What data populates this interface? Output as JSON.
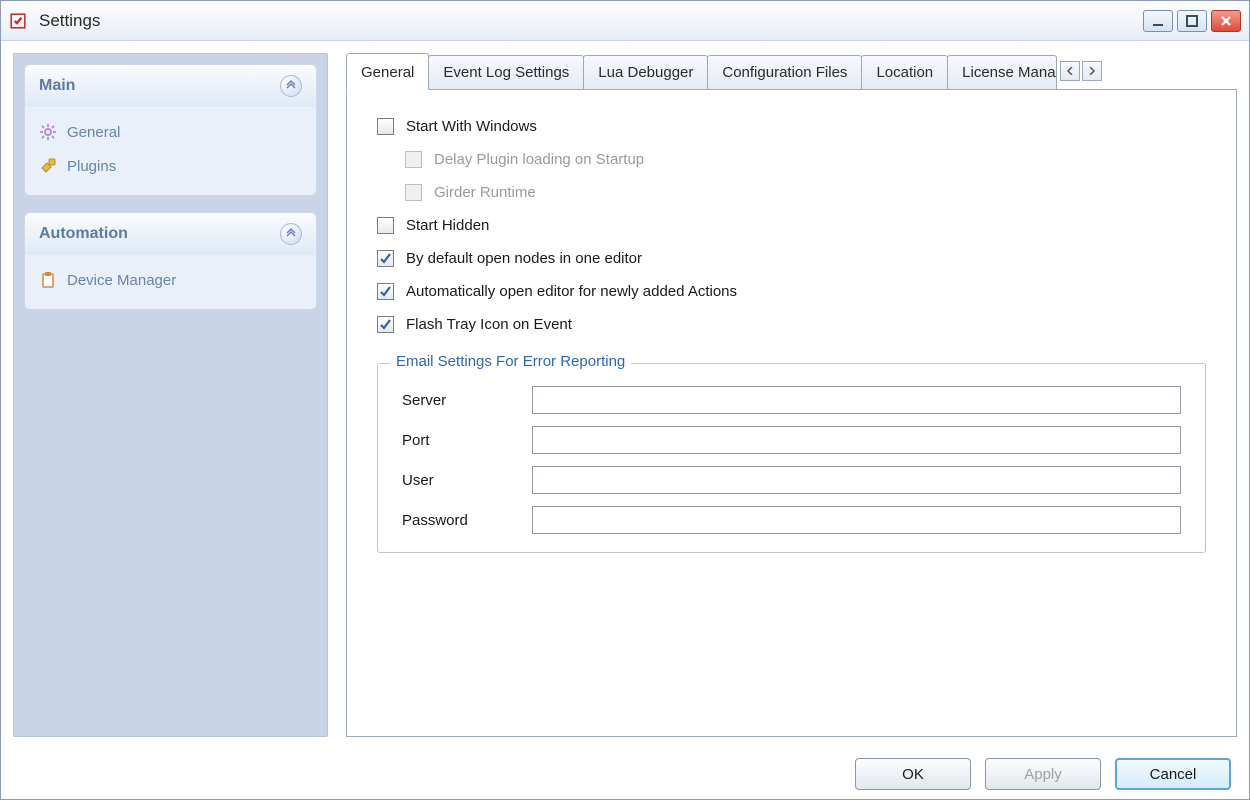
{
  "window": {
    "title": "Settings"
  },
  "sidebar": {
    "groups": [
      {
        "title": "Main",
        "items": [
          {
            "label": "General"
          },
          {
            "label": "Plugins"
          }
        ]
      },
      {
        "title": "Automation",
        "items": [
          {
            "label": "Device Manager"
          }
        ]
      }
    ]
  },
  "tabs": {
    "items": [
      {
        "label": "General"
      },
      {
        "label": "Event Log Settings"
      },
      {
        "label": "Lua Debugger"
      },
      {
        "label": "Configuration Files"
      },
      {
        "label": "Location"
      },
      {
        "label": "License Manager"
      }
    ]
  },
  "general": {
    "checkboxes": {
      "start_with_windows": "Start With Windows",
      "delay_plugin": "Delay Plugin loading on Startup",
      "girder_runtime": "Girder Runtime",
      "start_hidden": "Start Hidden",
      "open_one_editor": "By default open nodes in one editor",
      "auto_open_editor": "Automatically open editor for newly added Actions",
      "flash_tray": "Flash Tray Icon on Event"
    },
    "email_group": {
      "legend": "Email Settings For Error Reporting",
      "server_label": "Server",
      "port_label": "Port",
      "user_label": "User",
      "password_label": "Password",
      "server": "",
      "port": "",
      "user": "",
      "password": ""
    }
  },
  "buttons": {
    "ok": "OK",
    "apply": "Apply",
    "cancel": "Cancel"
  }
}
